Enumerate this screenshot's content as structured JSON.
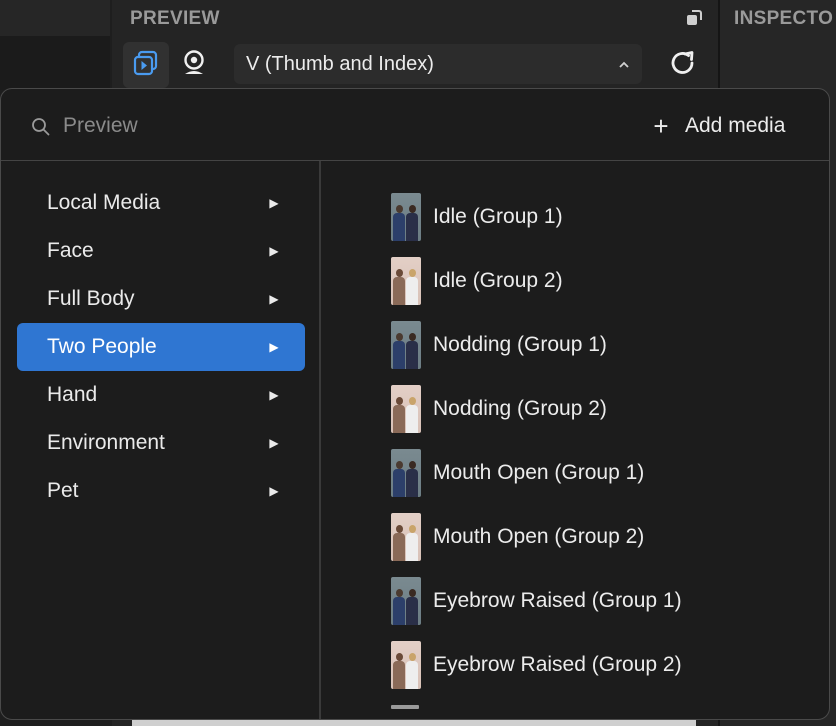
{
  "preview_panel": {
    "title": "PREVIEW",
    "dropdown_value": "V (Thumb and Index)"
  },
  "inspector_panel": {
    "title": "INSPECTO"
  },
  "popup": {
    "search": {
      "placeholder": "Preview",
      "value": ""
    },
    "add_media_label": "Add media",
    "categories": [
      {
        "label": "Local Media",
        "selected": false
      },
      {
        "label": "Face",
        "selected": false
      },
      {
        "label": "Full Body",
        "selected": false
      },
      {
        "label": "Two People",
        "selected": true
      },
      {
        "label": "Hand",
        "selected": false
      },
      {
        "label": "Environment",
        "selected": false
      },
      {
        "label": "Pet",
        "selected": false
      }
    ],
    "media_items": [
      {
        "label": "Idle (Group 1)"
      },
      {
        "label": "Idle (Group 2)"
      },
      {
        "label": "Nodding (Group 1)"
      },
      {
        "label": "Nodding (Group 2)"
      },
      {
        "label": "Mouth Open (Group 1)"
      },
      {
        "label": "Mouth Open (Group 2)"
      },
      {
        "label": "Eyebrow Raised (Group 1)"
      },
      {
        "label": "Eyebrow Raised (Group 2)"
      }
    ]
  },
  "colors": {
    "selected_accent": "#2f76d2",
    "popup_background": "#1c1c1c",
    "panel_background": "#242424"
  },
  "icons": {
    "source": "preview-source-icon",
    "camera": "webcam-icon",
    "dropdown": "chevron-up-icon",
    "refresh": "refresh-icon",
    "maximize": "maximize-icon",
    "search": "search-icon",
    "add": "plus-icon",
    "submenu": "triangle-right-icon"
  }
}
